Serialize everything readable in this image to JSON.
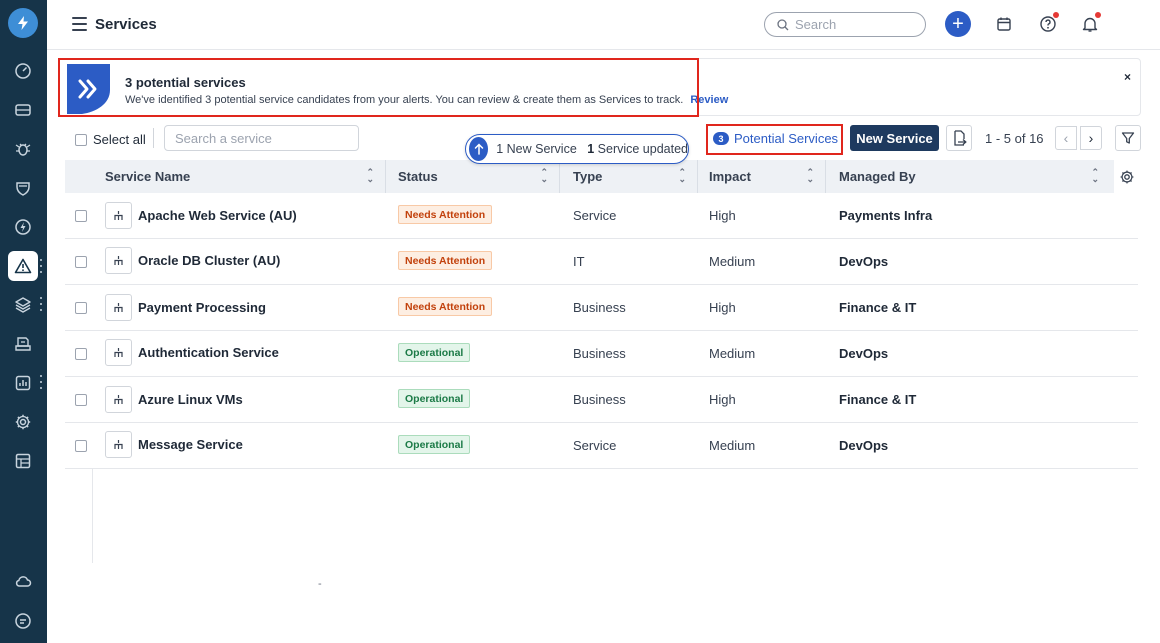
{
  "header": {
    "title": "Services",
    "search_placeholder": "Search"
  },
  "banner": {
    "title": "3 potential services",
    "text": "We've identified 3 potential service candidates from your alerts. You can review & create them as Services to track.",
    "review_label": "Review",
    "close_label": "×"
  },
  "toolbar": {
    "select_all_label": "Select all",
    "search_placeholder": "Search a service",
    "updates": {
      "new_count": "1",
      "new_label": "New Service",
      "updated_count": "1",
      "updated_label": "Service updated"
    },
    "potential_count": "3",
    "potential_label": "Potential Services",
    "new_service_label": "New Service",
    "pagination": "1 - 5 of 16"
  },
  "table": {
    "columns": [
      "Service Name",
      "Status",
      "Type",
      "Impact",
      "Managed By"
    ],
    "rows": [
      {
        "name": "Apache Web Service (AU)",
        "status": "Needs Attention",
        "type": "Service",
        "impact": "High",
        "managed_by": "Payments Infra"
      },
      {
        "name": "Oracle DB Cluster (AU)",
        "status": "Needs Attention",
        "type": "IT",
        "impact": "Medium",
        "managed_by": "DevOps"
      },
      {
        "name": "Payment Processing",
        "status": "Needs Attention",
        "type": "Business",
        "impact": "High",
        "managed_by": "Finance & IT"
      },
      {
        "name": "Authentication Service",
        "status": "Operational",
        "type": "Business",
        "impact": "Medium",
        "managed_by": "DevOps"
      },
      {
        "name": "Azure Linux VMs",
        "status": "Operational",
        "type": "Business",
        "impact": "High",
        "managed_by": "Finance & IT"
      },
      {
        "name": "Message Service",
        "status": "Operational",
        "type": "Service",
        "impact": "Medium",
        "managed_by": "DevOps"
      }
    ]
  },
  "footer_mark": "-",
  "colors": {
    "sidebar": "#163449",
    "accent": "#2c5cc5",
    "primary_button": "#1e3a5f",
    "highlight": "#e0261d",
    "attention": "#c2410c",
    "operational": "#1b7a46"
  },
  "sidebar_icons": [
    "logo-icon",
    "dashboard-icon",
    "tickets-icon",
    "bug-icon",
    "shield-icon",
    "bolt-icon",
    "alert-icon",
    "layers-icon",
    "inbox-icon",
    "reports-icon",
    "settings-icon",
    "table-icon",
    "cloud-icon",
    "chat-icon"
  ]
}
